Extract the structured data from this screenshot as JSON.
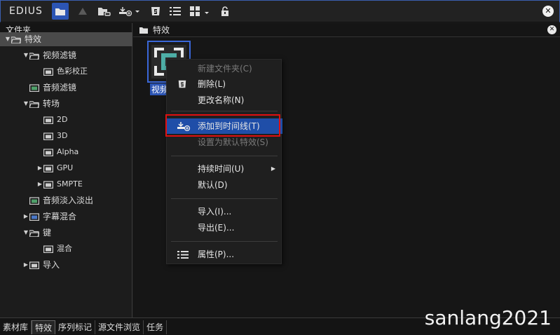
{
  "app": {
    "logo": "EDIUS"
  },
  "toolbar": {
    "icons": [
      "folder-icon",
      "up-icon",
      "folder-link-icon",
      "add-to-timeline-icon",
      "delete-icon",
      "list-view-icon",
      "grid-view-icon",
      "lock-icon"
    ]
  },
  "left_panel": {
    "header": "文件夹",
    "tree": [
      {
        "label": "特效",
        "level": 0,
        "expand": "down",
        "icon": "folder-open",
        "selected": true
      },
      {
        "label": "视频滤镜",
        "level": 1,
        "expand": "down",
        "icon": "folder-open"
      },
      {
        "label": "色彩校正",
        "level": 2,
        "expand": "",
        "icon": "folder"
      },
      {
        "label": "音频滤镜",
        "level": 1,
        "expand": "",
        "icon": "audio-folder"
      },
      {
        "label": "转场",
        "level": 1,
        "expand": "down",
        "icon": "folder-open"
      },
      {
        "label": "2D",
        "level": 2,
        "expand": "",
        "icon": "folder"
      },
      {
        "label": "3D",
        "level": 2,
        "expand": "",
        "icon": "folder"
      },
      {
        "label": "Alpha",
        "level": 2,
        "expand": "",
        "icon": "folder"
      },
      {
        "label": "GPU",
        "level": 2,
        "expand": "right",
        "icon": "folder"
      },
      {
        "label": "SMPTE",
        "level": 2,
        "expand": "right",
        "icon": "folder"
      },
      {
        "label": "音频淡入淡出",
        "level": 1,
        "expand": "",
        "icon": "audio-folder"
      },
      {
        "label": "字幕混合",
        "level": 1,
        "expand": "right",
        "icon": "title-folder"
      },
      {
        "label": "键",
        "level": 1,
        "expand": "down",
        "icon": "folder-open"
      },
      {
        "label": "混合",
        "level": 2,
        "expand": "",
        "icon": "folder"
      },
      {
        "label": "导入",
        "level": 1,
        "expand": "right",
        "icon": "folder"
      }
    ]
  },
  "right_panel": {
    "header": "特效",
    "item_label": "视频"
  },
  "context_menu": {
    "items": [
      {
        "label": "新建文件夹(C)",
        "disabled": true,
        "icon": ""
      },
      {
        "label": "删除(L)",
        "disabled": false,
        "icon": "delete-icon"
      },
      {
        "label": "更改名称(N)",
        "disabled": false,
        "icon": ""
      },
      {
        "label": "添加到时间线(T)",
        "disabled": false,
        "icon": "add-to-timeline-icon",
        "highlighted": true
      },
      {
        "label": "设置为默认特效(S)",
        "disabled": true,
        "icon": ""
      },
      {
        "label": "持续时间(U)",
        "disabled": false,
        "icon": "",
        "submenu": true
      },
      {
        "label": "默认(D)",
        "disabled": false,
        "icon": ""
      },
      {
        "label": "导入(I)...",
        "disabled": false,
        "icon": ""
      },
      {
        "label": "导出(E)...",
        "disabled": false,
        "icon": ""
      },
      {
        "label": "属性(P)...",
        "disabled": false,
        "icon": "list-icon"
      }
    ]
  },
  "bottom_tabs": [
    {
      "label": "素材库",
      "active": false
    },
    {
      "label": "特效",
      "active": true
    },
    {
      "label": "序列标记",
      "active": false
    },
    {
      "label": "源文件浏览",
      "active": false
    },
    {
      "label": "任务",
      "active": false
    }
  ],
  "watermark": "sanlang2021",
  "colors": {
    "accent": "#2c55b5",
    "highlight_border": "#e01010",
    "menu_highlight": "#1f4ea8"
  }
}
